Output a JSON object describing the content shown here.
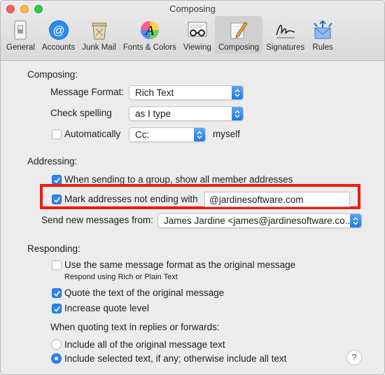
{
  "window": {
    "title": "Composing"
  },
  "toolbar": {
    "items": [
      {
        "label": "General",
        "icon": "general-icon"
      },
      {
        "label": "Accounts",
        "icon": "accounts-icon"
      },
      {
        "label": "Junk Mail",
        "icon": "junk-mail-icon"
      },
      {
        "label": "Fonts & Colors",
        "icon": "fonts-colors-icon"
      },
      {
        "label": "Viewing",
        "icon": "viewing-icon"
      },
      {
        "label": "Composing",
        "icon": "composing-icon",
        "active": true
      },
      {
        "label": "Signatures",
        "icon": "signatures-icon"
      },
      {
        "label": "Rules",
        "icon": "rules-icon"
      }
    ]
  },
  "composing": {
    "heading": "Composing:",
    "message_format_label": "Message Format:",
    "message_format_value": "Rich Text",
    "check_spelling_label": "Check spelling",
    "check_spelling_value": "as I type",
    "automatically_label": "Automatically",
    "automatically_checked": false,
    "cc_value": "Cc:",
    "myself_label": "myself"
  },
  "addressing": {
    "heading": "Addressing:",
    "group_label": "When sending to a group, show all member addresses",
    "group_checked": true,
    "mark_label": "Mark addresses not ending with",
    "mark_checked": true,
    "mark_domain": "@jardinesoftware.com",
    "send_from_label": "Send new messages from:",
    "send_from_value": "James Jardine <james@jardinesoftware.co..."
  },
  "responding": {
    "heading": "Responding:",
    "same_format_label": "Use the same message format as the original message",
    "same_format_checked": false,
    "same_format_hint": "Respond using Rich or Plain Text",
    "quote_label": "Quote the text of the original message",
    "quote_checked": true,
    "increase_label": "Increase quote level",
    "increase_checked": true,
    "quoting_heading": "When quoting text in replies or forwards:",
    "include_all_label": "Include all of the original message text",
    "include_selected_label": "Include selected text, if any; otherwise include all text",
    "selected_option": "include_selected"
  },
  "help": {
    "label": "?"
  },
  "colors": {
    "accent": "#2e84ee",
    "highlight": "#f01a0e"
  }
}
